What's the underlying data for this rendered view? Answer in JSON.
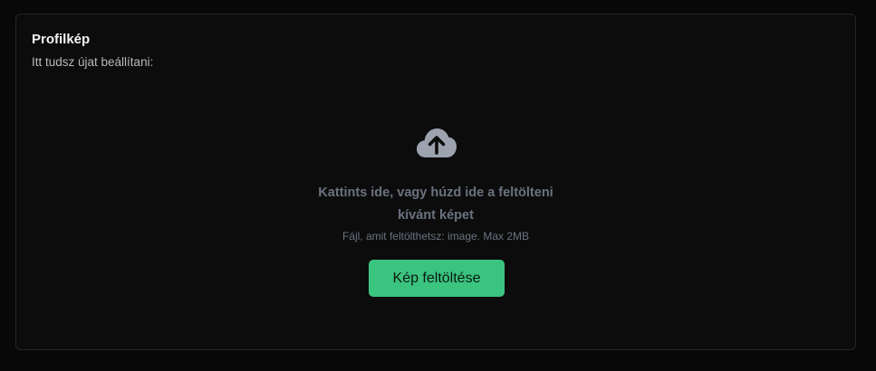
{
  "card": {
    "title": "Profilkép",
    "subtitle": "Itt tudsz újat beállítani:"
  },
  "dropzone": {
    "icon": "cloud-upload-icon",
    "line1": "Kattints ide, vagy húzd ide a feltölteni",
    "line2": "kívánt képet",
    "hint": "Fájl, amit feltölthetsz: image. Max 2MB",
    "button_label": "Kép feltöltése"
  },
  "colors": {
    "background": "#080808",
    "card_border": "#262626",
    "muted_text": "#6b7280",
    "icon": "#9ca3af",
    "accent": "#3bc47f"
  }
}
